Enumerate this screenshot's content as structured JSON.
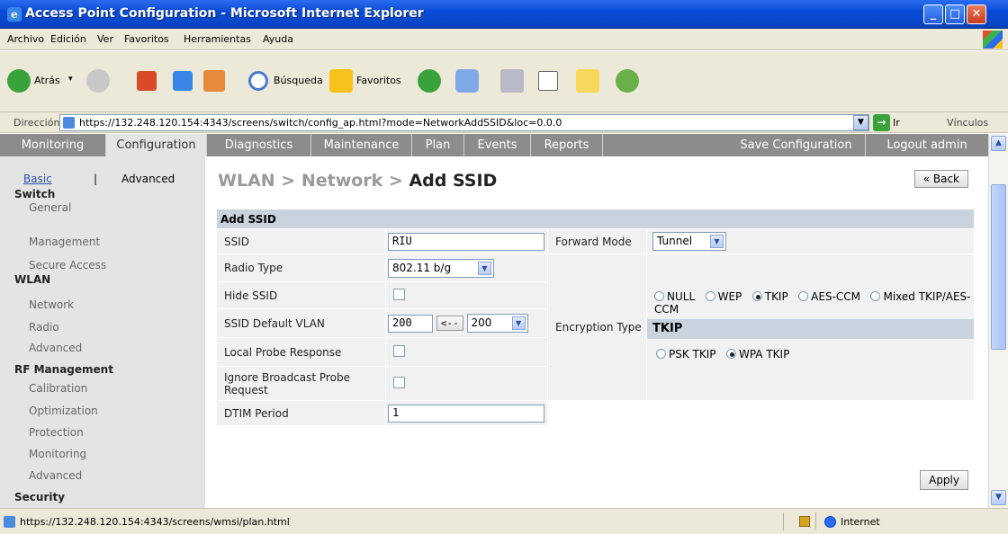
{
  "window": {
    "title": "Access Point Configuration - Microsoft Internet Explorer"
  },
  "menu": [
    "Archivo",
    "Edición",
    "Ver",
    "Favoritos",
    "Herramientas",
    "Ayuda"
  ],
  "toolbar": {
    "back": "Atrás",
    "search": "Búsqueda",
    "favorites": "Favoritos"
  },
  "address": {
    "label": "Dirección",
    "url": "https://132.248.120.154:4343/screens/switch/config_ap.html?mode=NetworkAddSSID&loc=0.0.0",
    "go": "Ir",
    "links": "Vínculos"
  },
  "tabs": [
    "Monitoring",
    "Configuration",
    "Diagnostics",
    "Maintenance",
    "Plan",
    "Events",
    "Reports"
  ],
  "tabs_right": [
    "Save Configuration",
    "Logout admin"
  ],
  "sidebar": {
    "basic": "Basic",
    "separator": "|",
    "advanced": "Advanced",
    "sections": [
      {
        "title": "Switch",
        "items": [
          "General",
          "Management",
          "Secure Access"
        ]
      },
      {
        "title": "WLAN",
        "items": [
          "Network",
          "Radio",
          "Advanced"
        ]
      },
      {
        "title": "RF Management",
        "items": [
          "Calibration",
          "Optimization",
          "Protection",
          "Monitoring",
          "Advanced"
        ]
      },
      {
        "title": "Security",
        "items": []
      }
    ]
  },
  "breadcrumb": {
    "part1": "WLAN > Network > ",
    "current": "Add SSID"
  },
  "back_button": "« Back",
  "form": {
    "header": "Add SSID",
    "ssid_label": "SSID",
    "ssid_value": "RIU",
    "radio_type_label": "Radio Type",
    "radio_type_value": "802.11 b/g",
    "hide_ssid_label": "Hide SSID",
    "default_vlan_label": "SSID Default VLAN",
    "default_vlan_value": "200",
    "vlan_copy_button": "<--",
    "vlan_select_value": "200",
    "local_probe_label": "Local Probe Response",
    "ignore_probe_label": "Ignore Broadcast Probe Request",
    "dtim_label": "DTIM Period",
    "dtim_value": "1",
    "forward_mode_label": "Forward Mode",
    "forward_mode_value": "Tunnel",
    "encryption_label": "Encryption Type",
    "encryption_options": [
      "NULL",
      "WEP",
      "TKIP",
      "AES-CCM",
      "Mixed TKIP/AES-CCM"
    ],
    "encryption_selected": "TKIP",
    "tkip_header": "TKIP",
    "tkip_options": [
      "PSK TKIP",
      "WPA TKIP"
    ],
    "tkip_selected": "WPA TKIP"
  },
  "apply_button": "Apply",
  "status": {
    "url": "https://132.248.120.154:4343/screens/wmsi/plan.html",
    "zone": "Internet"
  }
}
